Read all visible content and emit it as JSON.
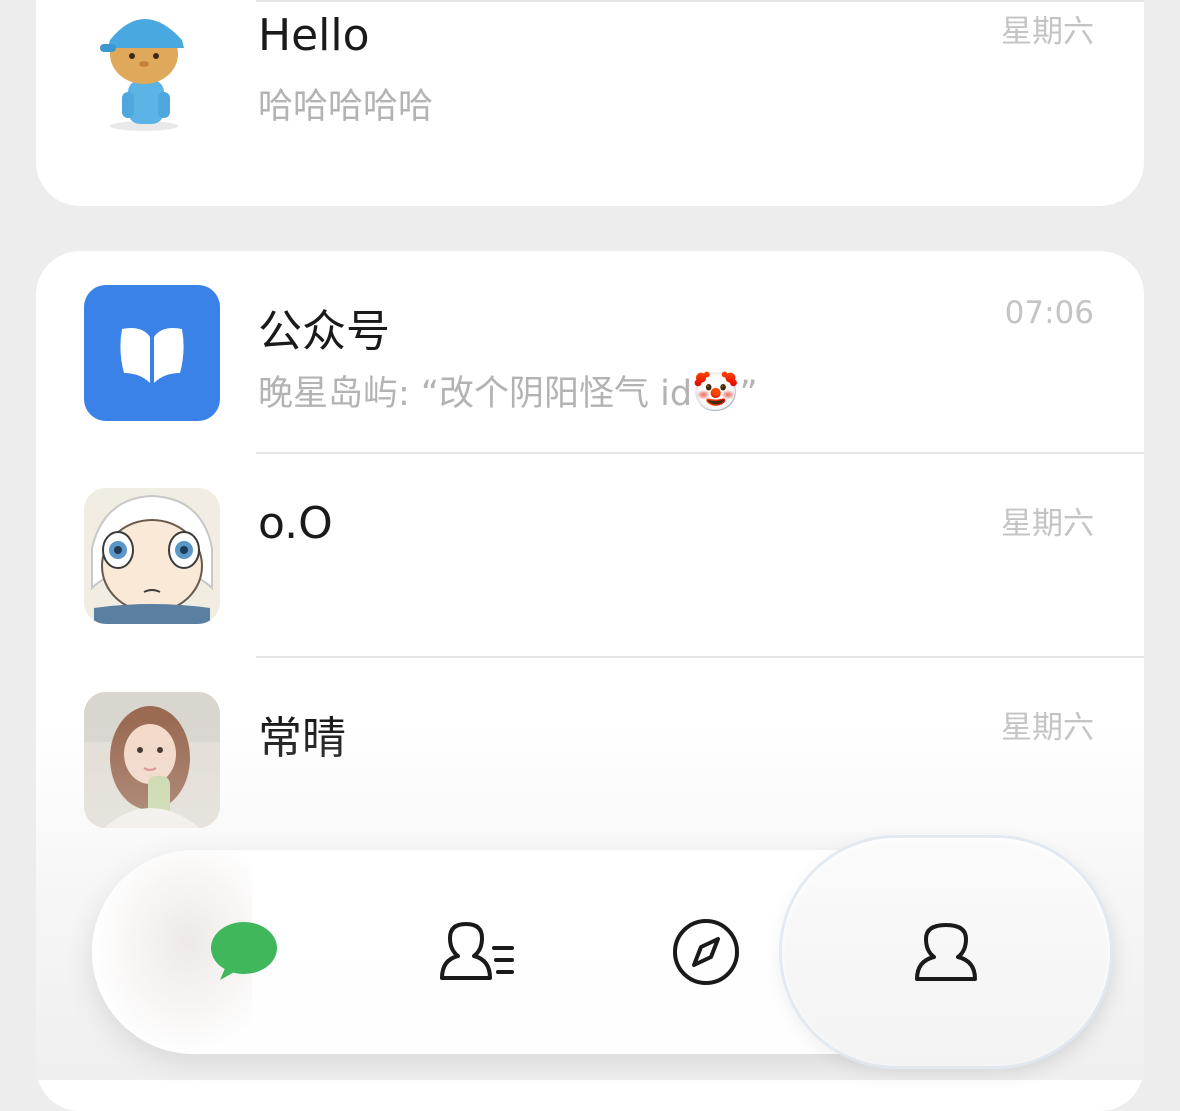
{
  "chats_top": [
    {
      "name": "Hello",
      "preview": "哈哈哈哈哈",
      "time": "星期六"
    }
  ],
  "chats": [
    {
      "name": "公众号",
      "preview": "晚星岛屿: “改个阴阳怪气 id",
      "preview_emoji": "🤡",
      "preview_end": "”",
      "time": "07:06"
    },
    {
      "name": "o.O",
      "preview": "",
      "time": "星期六"
    },
    {
      "name": "常晴",
      "preview": "",
      "time": "星期六"
    }
  ],
  "tabbar": {
    "tabs": [
      {
        "id": "chats",
        "icon": "chat-bubble-icon"
      },
      {
        "id": "contacts",
        "icon": "contacts-icon"
      },
      {
        "id": "discover",
        "icon": "compass-icon"
      },
      {
        "id": "me",
        "icon": "person-icon"
      }
    ],
    "accent": "#3fb75a"
  },
  "colors": {
    "official_account_blue": "#3a82e8"
  }
}
